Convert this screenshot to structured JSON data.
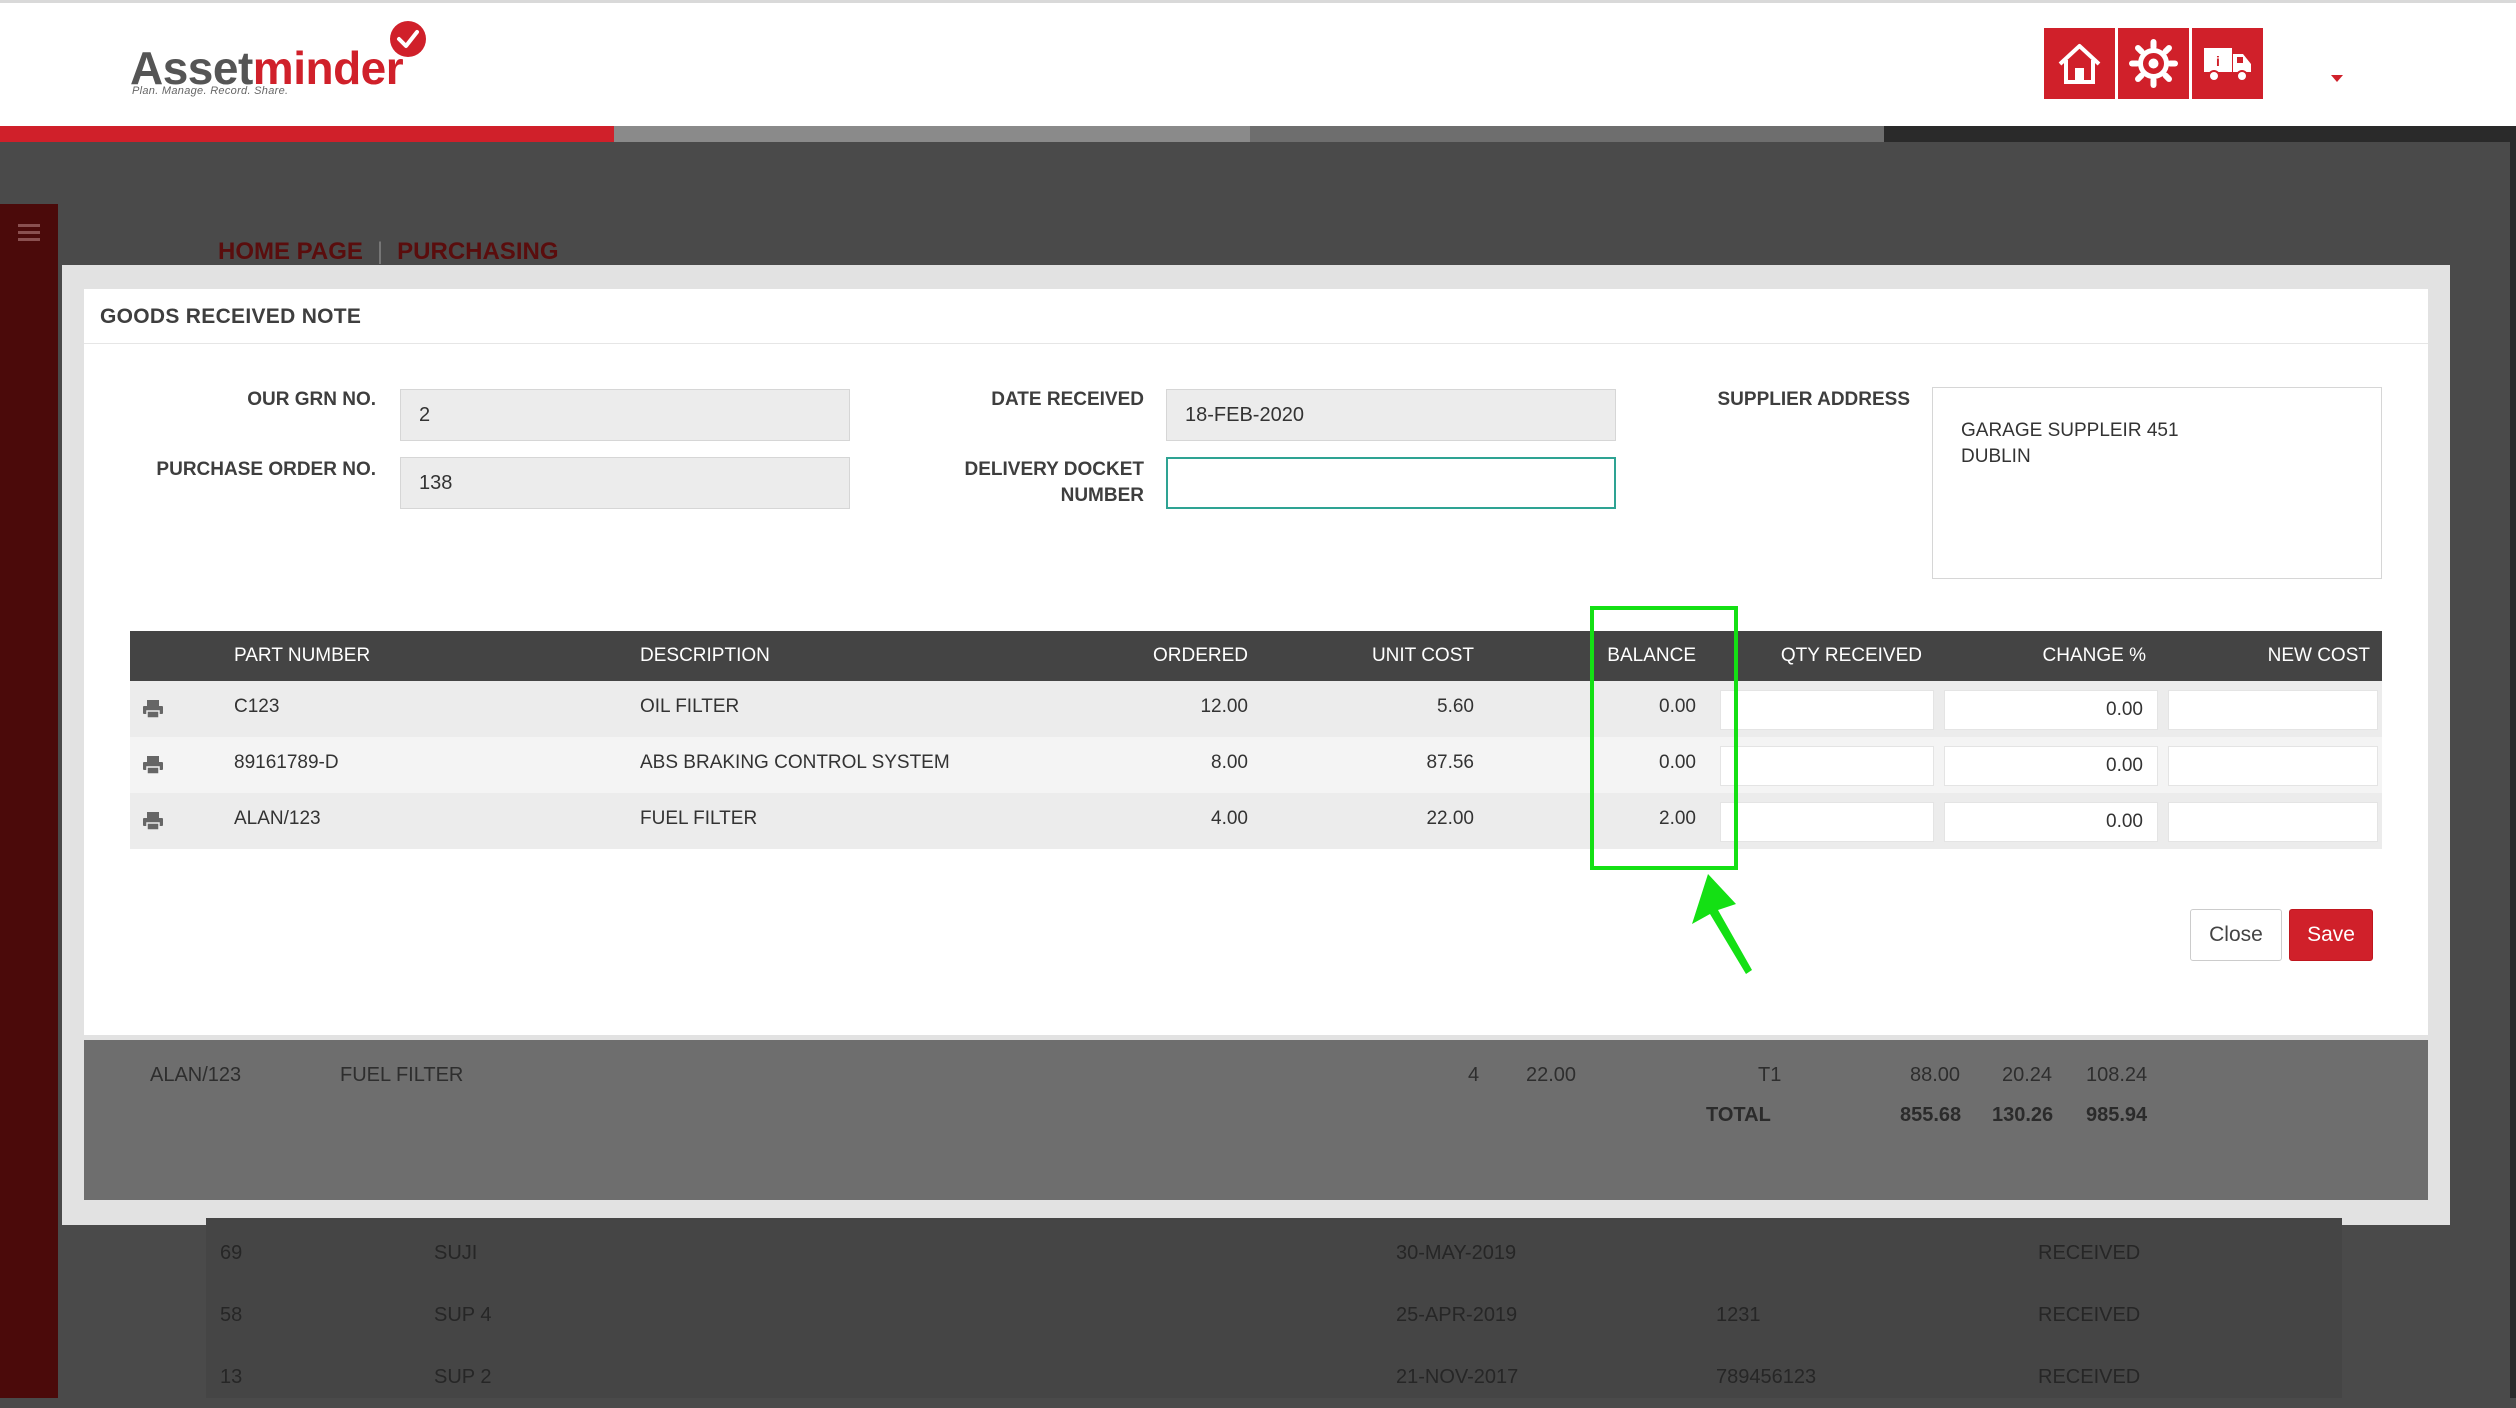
{
  "brand": {
    "name_part1": "Asset",
    "name_part2": "minder",
    "tagline": "Plan. Manage. Record. Share.",
    "accent_color": "#d0202a"
  },
  "header_buttons": [
    {
      "icon": "home-icon"
    },
    {
      "icon": "gear-icon"
    },
    {
      "icon": "truck-icon"
    }
  ],
  "breadcrumb": {
    "home": "HOME PAGE",
    "section": "PURCHASING"
  },
  "modal": {
    "title": "GOODS RECEIVED NOTE",
    "grn_label": "OUR GRN NO.",
    "grn_value": "2",
    "po_label": "PURCHASE ORDER NO.",
    "po_value": "138",
    "date_label": "DATE RECEIVED",
    "date_value": "18-FEB-2020",
    "docket_label_line1": "DELIVERY DOCKET",
    "docket_label_line2": "NUMBER",
    "docket_value": "",
    "supplier_label": "SUPPLIER ADDRESS",
    "supplier_line1": "GARAGE SUPPLEIR 451",
    "supplier_line2": "DUBLIN",
    "close_label": "Close",
    "save_label": "Save"
  },
  "table": {
    "headers": {
      "part": "PART NUMBER",
      "desc": "DESCRIPTION",
      "ordered": "ORDERED",
      "unit_cost": "UNIT COST",
      "balance": "BALANCE",
      "qty": "QTY RECEIVED",
      "change": "CHANGE %",
      "new_cost": "NEW COST"
    },
    "rows": [
      {
        "part": "C123",
        "desc": "OIL FILTER",
        "ordered": "12.00",
        "unit_cost": "5.60",
        "balance": "0.00",
        "qty": "",
        "change": "0.00",
        "new_cost": ""
      },
      {
        "part": "89161789-D",
        "desc": "ABS BRAKING CONTROL SYSTEM",
        "ordered": "8.00",
        "unit_cost": "87.56",
        "balance": "0.00",
        "qty": "",
        "change": "0.00",
        "new_cost": ""
      },
      {
        "part": "ALAN/123",
        "desc": "FUEL FILTER",
        "ordered": "4.00",
        "unit_cost": "22.00",
        "balance": "2.00",
        "qty": "",
        "change": "0.00",
        "new_cost": ""
      }
    ]
  },
  "background": {
    "order_line": {
      "part": "ALAN/123",
      "desc": "FUEL FILTER",
      "qty": "4",
      "cost": "22.00",
      "tax_code": "T1",
      "net": "88.00",
      "vat": "20.24",
      "gross": "108.24"
    },
    "totals": {
      "label": "TOTAL",
      "net": "855.68",
      "vat": "130.26",
      "gross": "985.94"
    },
    "orders": [
      {
        "id": "69",
        "supplier": "SUJI",
        "date": "30-MAY-2019",
        "ref": "",
        "status": "RECEIVED"
      },
      {
        "id": "58",
        "supplier": "SUP 4",
        "date": "25-APR-2019",
        "ref": "1231",
        "status": "RECEIVED"
      },
      {
        "id": "13",
        "supplier": "SUP 2",
        "date": "21-NOV-2017",
        "ref": "789456123",
        "status": "RECEIVED"
      }
    ]
  },
  "annotation": {
    "highlight_color": "#14e014"
  }
}
